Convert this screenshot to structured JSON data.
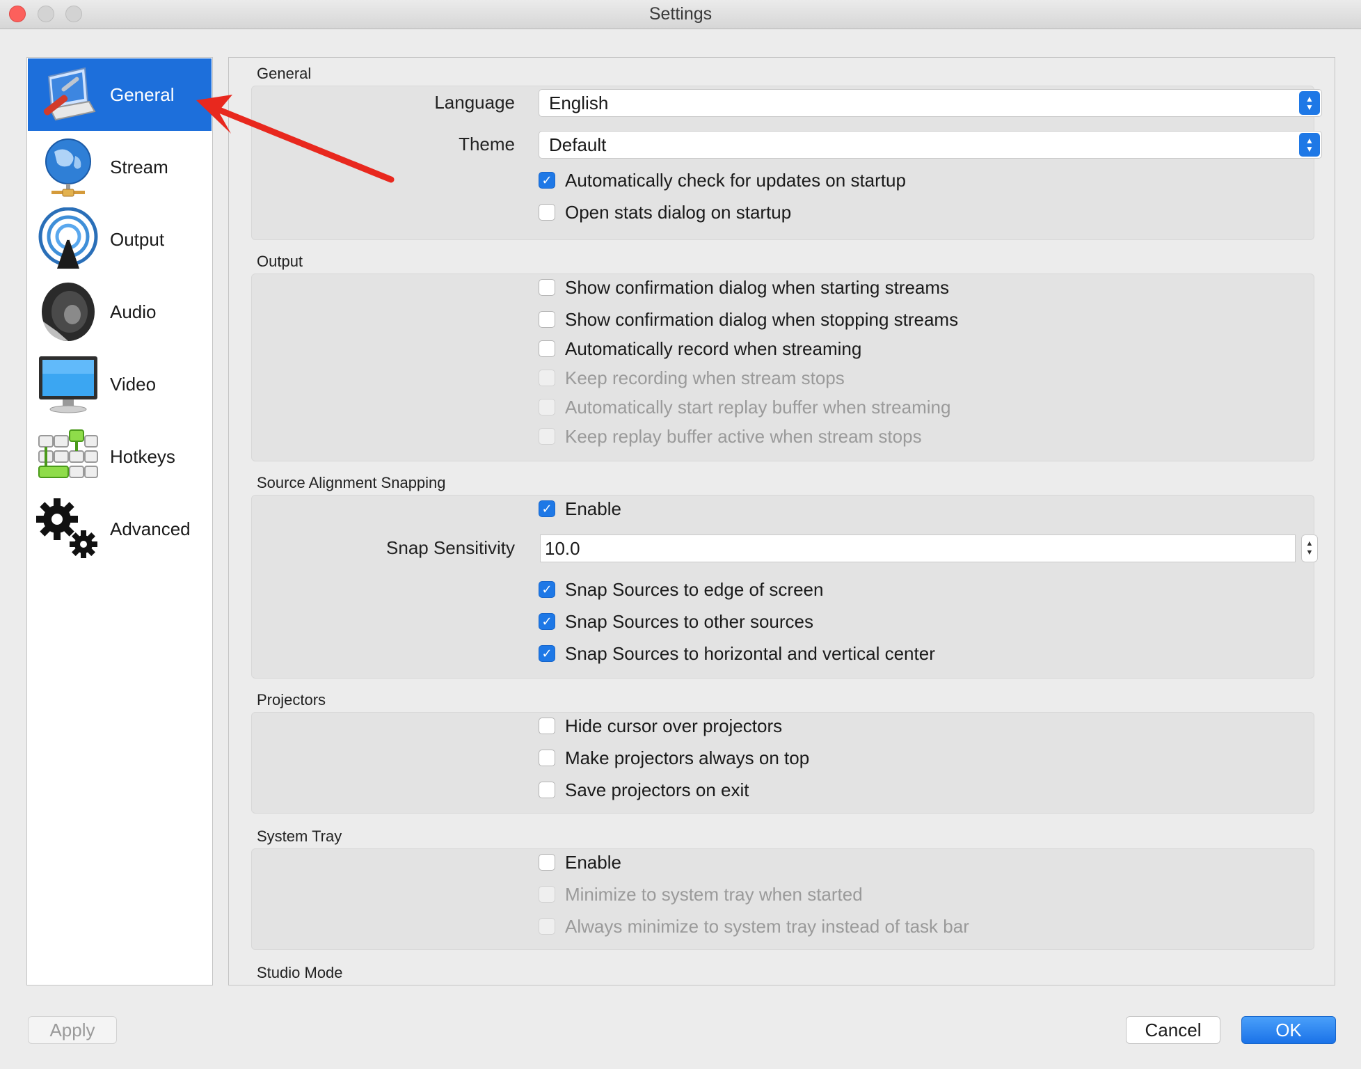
{
  "window": {
    "title": "Settings"
  },
  "sidebar": {
    "items": [
      {
        "label": "General",
        "icon": "general-icon",
        "active": true
      },
      {
        "label": "Stream",
        "icon": "globe-icon"
      },
      {
        "label": "Output",
        "icon": "broadcast-icon"
      },
      {
        "label": "Audio",
        "icon": "speaker-icon"
      },
      {
        "label": "Video",
        "icon": "monitor-icon"
      },
      {
        "label": "Hotkeys",
        "icon": "keyboard-icon"
      },
      {
        "label": "Advanced",
        "icon": "gears-icon"
      }
    ]
  },
  "general": {
    "title": "General",
    "language_label": "Language",
    "language_value": "English",
    "theme_label": "Theme",
    "theme_value": "Default",
    "check_updates": {
      "label": "Automatically check for updates on startup",
      "checked": true
    },
    "open_stats": {
      "label": "Open stats dialog on startup",
      "checked": false
    }
  },
  "output": {
    "title": "Output",
    "items": [
      {
        "label": "Show confirmation dialog when starting streams",
        "checked": false,
        "enabled": true
      },
      {
        "label": "Show confirmation dialog when stopping streams",
        "checked": false,
        "enabled": true
      },
      {
        "label": "Automatically record when streaming",
        "checked": false,
        "enabled": true
      },
      {
        "label": "Keep recording when stream stops",
        "checked": false,
        "enabled": false
      },
      {
        "label": "Automatically start replay buffer when streaming",
        "checked": false,
        "enabled": false
      },
      {
        "label": "Keep replay buffer active when stream stops",
        "checked": false,
        "enabled": false
      }
    ]
  },
  "snapping": {
    "title": "Source Alignment Snapping",
    "enable": {
      "label": "Enable",
      "checked": true
    },
    "sensitivity_label": "Snap Sensitivity",
    "sensitivity_value": "10.0",
    "items": [
      {
        "label": "Snap Sources to edge of screen",
        "checked": true
      },
      {
        "label": "Snap Sources to other sources",
        "checked": true
      },
      {
        "label": "Snap Sources to horizontal and vertical center",
        "checked": true
      }
    ]
  },
  "projectors": {
    "title": "Projectors",
    "items": [
      {
        "label": "Hide cursor over projectors",
        "checked": false
      },
      {
        "label": "Make projectors always on top",
        "checked": false
      },
      {
        "label": "Save projectors on exit",
        "checked": false
      }
    ]
  },
  "system_tray": {
    "title": "System Tray",
    "items": [
      {
        "label": "Enable",
        "checked": false,
        "enabled": true
      },
      {
        "label": "Minimize to system tray when started",
        "checked": false,
        "enabled": false
      },
      {
        "label": "Always minimize to system tray instead of task bar",
        "checked": false,
        "enabled": false
      }
    ]
  },
  "studio_mode": {
    "title": "Studio Mode"
  },
  "buttons": {
    "apply": "Apply",
    "cancel": "Cancel",
    "ok": "OK"
  },
  "colors": {
    "accent": "#1e78e6",
    "sidebar_active": "#1d6fdb",
    "annotation_arrow": "#e8281e"
  }
}
